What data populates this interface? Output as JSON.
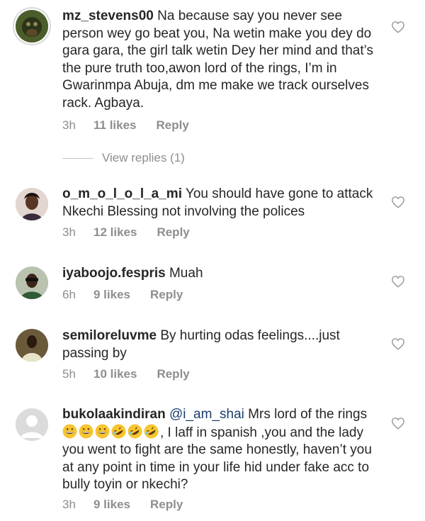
{
  "comments": [
    {
      "username": "mz_stevens00",
      "text": "Na because say you never see person wey go beat you, Na wetin make you dey do gara gara, the girl talk wetin Dey her mind and that’s the pure truth too,awon lord of the rings, I’m in Gwarinmpa Abuja, dm me make we track ourselves rack. Agbaya.",
      "time": "3h",
      "likes": "11 likes",
      "reply": "Reply",
      "view_replies": "View replies (1)"
    },
    {
      "username": "o_m_o_l_o_l_a_mi",
      "text": "You should have gone to attack Nkechi Blessing not involving the polices",
      "time": "3h",
      "likes": "12 likes",
      "reply": "Reply"
    },
    {
      "username": "iyaboojo.fespris",
      "text": "Muah",
      "time": "6h",
      "likes": "9 likes",
      "reply": "Reply"
    },
    {
      "username": "semiloreluvme",
      "text": "By hurting odas feelings....just passing by",
      "time": "5h",
      "likes": "10 likes",
      "reply": "Reply"
    },
    {
      "username": "bukolaakindiran",
      "mention": "@i_am_shai",
      "text_before_emoji": "Mrs lord of the rings",
      "emojis": [
        "grinning-face",
        "grinning-face",
        "grinning-face",
        "rofl-face",
        "rofl-face",
        "rofl-face"
      ],
      "text_after_emoji": ", I laff in spanish ,you and the lady you went to fight are the same honestly, haven’t you at any point in time in your life hid under fake acc to bully toyin or nkechi?",
      "time": "3h",
      "likes": "9 likes",
      "reply": "Reply"
    }
  ],
  "icons": {
    "like": "heart-outline-icon"
  },
  "colors": {
    "text": "#262626",
    "muted": "#8e8e8e",
    "mention": "#1c3e6e"
  }
}
